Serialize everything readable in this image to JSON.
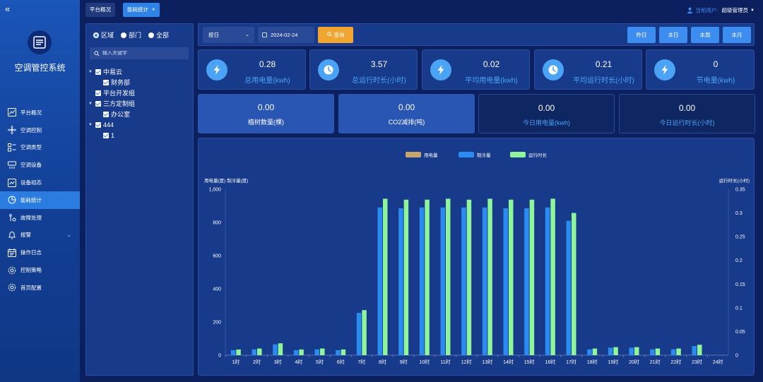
{
  "app": {
    "title": "空调管控系统"
  },
  "sidebar": {
    "items": [
      {
        "label": "平台概况",
        "icon": "line-chart-icon",
        "active": false
      },
      {
        "label": "空调控制",
        "icon": "fan-icon",
        "active": false
      },
      {
        "label": "空调类型",
        "icon": "list-icon",
        "active": false
      },
      {
        "label": "空调设备",
        "icon": "ac-unit-icon",
        "active": false
      },
      {
        "label": "设备组态",
        "icon": "chart-box-icon",
        "active": false
      },
      {
        "label": "能耗统计",
        "icon": "pie-chart-icon",
        "active": true
      },
      {
        "label": "故障处理",
        "icon": "wrench-icon",
        "active": false
      },
      {
        "label": "报警",
        "icon": "bell-icon",
        "active": false
      },
      {
        "label": "操作日志",
        "icon": "calendar-icon",
        "active": false
      },
      {
        "label": "控制策略",
        "icon": "gear-icon",
        "active": false
      },
      {
        "label": "首页配置",
        "icon": "gear-icon",
        "active": false
      }
    ]
  },
  "tabs": [
    {
      "label": "平台概况"
    },
    {
      "label": "能耗统计",
      "close": "×"
    }
  ],
  "user": {
    "label": "当前用户:",
    "name": "超级管理员"
  },
  "tree_panel": {
    "radios": [
      "区域",
      "部门",
      "全部"
    ],
    "selected": "区域",
    "search_placeholder": "输入关键字",
    "nodes": [
      {
        "label": "中易云",
        "level": 0,
        "expanded": true
      },
      {
        "label": "财务部",
        "level": 1
      },
      {
        "label": "平台开发组",
        "level": 0
      },
      {
        "label": "三方定制组",
        "level": 0,
        "expanded": true
      },
      {
        "label": "办公室",
        "level": 1
      },
      {
        "label": "444",
        "level": 0,
        "expanded": true
      },
      {
        "label": "1",
        "level": 1
      }
    ]
  },
  "filter": {
    "period_select": "按日",
    "date": "2024-02-24",
    "query_label": "查询",
    "period_buttons": [
      "昨日",
      "本日",
      "本周",
      "本月"
    ]
  },
  "stats": [
    {
      "value": "0.28",
      "label": "总用电量(kwh)",
      "icon": "lightning-icon"
    },
    {
      "value": "3.57",
      "label": "总运行时长(小时)",
      "icon": "clock-icon"
    },
    {
      "value": "0.02",
      "label": "平均用电量(kwh)",
      "icon": "lightning-icon"
    },
    {
      "value": "0.21",
      "label": "平均运行时长(小时)",
      "icon": "clock-icon"
    },
    {
      "value": "0",
      "label": "节电量(kwh)",
      "icon": "lightning-icon"
    }
  ],
  "big_stats": [
    {
      "value": "0.00",
      "label": "植树数量(棵)",
      "style": "light"
    },
    {
      "value": "0.00",
      "label": "CO2减排(吨)",
      "style": "light"
    },
    {
      "value": "0.00",
      "label": "今日用电量(kwh)",
      "style": "dark"
    },
    {
      "value": "0.00",
      "label": "今日运行时长(小时)",
      "style": "dark"
    }
  ],
  "colors": {
    "power": "#c8a46e",
    "cooling": "#2a8bf2",
    "runtime": "#8ff59a"
  },
  "chart_data": {
    "type": "bar",
    "categories": [
      "1时",
      "2时",
      "3时",
      "4时",
      "5时",
      "6时",
      "7时",
      "8时",
      "9时",
      "10时",
      "11时",
      "12时",
      "13时",
      "14时",
      "15时",
      "16时",
      "17时",
      "18时",
      "19时",
      "20时",
      "21时",
      "22时",
      "23时",
      "24时"
    ],
    "series": [
      {
        "name": "用电量",
        "axis": "left",
        "values": [
          0,
          0,
          0,
          0,
          0,
          0,
          0,
          0,
          0,
          0,
          0,
          0,
          0,
          0,
          0,
          0,
          0,
          0,
          0,
          0,
          0,
          0,
          0,
          0
        ]
      },
      {
        "name": "制冷量",
        "axis": "left",
        "values": [
          30,
          35,
          65,
          30,
          35,
          30,
          255,
          890,
          885,
          890,
          890,
          890,
          890,
          885,
          885,
          890,
          810,
          35,
          45,
          45,
          35,
          35,
          55,
          0
        ]
      },
      {
        "name": "运行时长",
        "axis": "right",
        "values": [
          0.012,
          0.014,
          0.025,
          0.012,
          0.014,
          0.012,
          0.095,
          0.33,
          0.328,
          0.328,
          0.33,
          0.328,
          0.33,
          0.328,
          0.328,
          0.33,
          0.3,
          0.014,
          0.017,
          0.017,
          0.014,
          0.014,
          0.022,
          0
        ]
      }
    ],
    "left_axis_title": "用电量(度) 制冷量(度)",
    "right_axis_title": "运行时长(小时)",
    "left_ylim": [
      0,
      1000
    ],
    "right_ylim": [
      0,
      0.35
    ],
    "left_ticks": [
      "0",
      "200",
      "400",
      "600",
      "800",
      "1,000"
    ],
    "right_ticks": [
      "0",
      "0.05",
      "0.1",
      "0.15",
      "0.2",
      "0.25",
      "0.3",
      "0.35"
    ],
    "legend": "top-center",
    "grid": false
  }
}
